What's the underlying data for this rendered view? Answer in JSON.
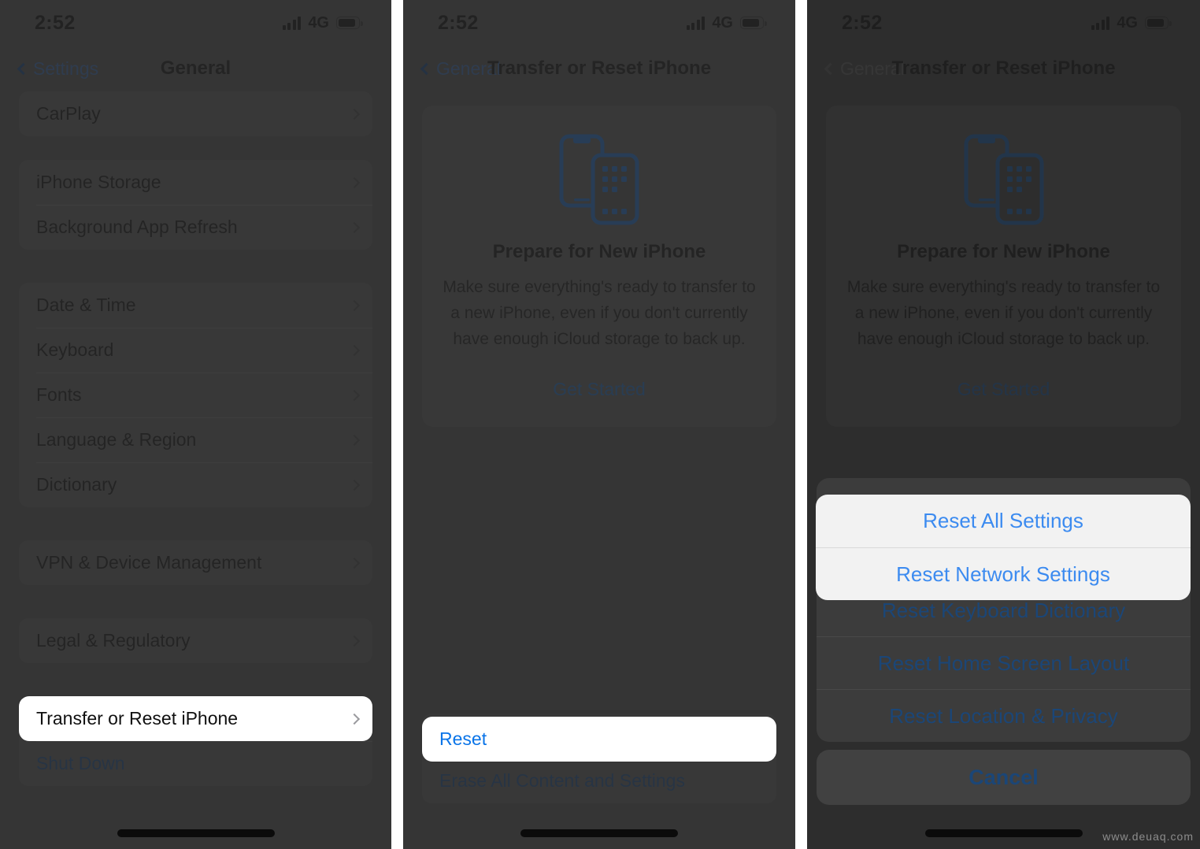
{
  "status_bar": {
    "time": "2:52",
    "network": "4G",
    "signal_icon": "signal-bars-icon",
    "battery_icon": "battery-icon"
  },
  "panel1": {
    "nav": {
      "back_label": "Settings",
      "title": "General",
      "back_icon": "chevron-left-icon"
    },
    "groups": [
      {
        "rows": [
          {
            "label": "CarPlay",
            "accessory": "chevron-right-icon"
          }
        ]
      },
      {
        "rows": [
          {
            "label": "iPhone Storage",
            "accessory": "chevron-right-icon"
          },
          {
            "label": "Background App Refresh",
            "accessory": "chevron-right-icon"
          }
        ]
      },
      {
        "rows": [
          {
            "label": "Date & Time",
            "accessory": "chevron-right-icon"
          },
          {
            "label": "Keyboard",
            "accessory": "chevron-right-icon"
          },
          {
            "label": "Fonts",
            "accessory": "chevron-right-icon"
          },
          {
            "label": "Language & Region",
            "accessory": "chevron-right-icon"
          },
          {
            "label": "Dictionary",
            "accessory": "chevron-right-icon"
          }
        ]
      },
      {
        "rows": [
          {
            "label": "VPN & Device Management",
            "accessory": "chevron-right-icon"
          }
        ]
      },
      {
        "rows": [
          {
            "label": "Legal & Regulatory",
            "accessory": "chevron-right-icon"
          }
        ]
      },
      {
        "rows": [
          {
            "label": "Transfer or Reset iPhone",
            "accessory": "chevron-right-icon",
            "highlighted": true
          },
          {
            "label": "Shut Down",
            "accessory": "",
            "link": true
          }
        ]
      }
    ]
  },
  "panel2": {
    "nav": {
      "back_label": "General",
      "title": "Transfer or Reset iPhone",
      "back_icon": "chevron-left-icon"
    },
    "prepare_card": {
      "icon": "two-phones-icon",
      "title": "Prepare for New iPhone",
      "body": "Make sure everything's ready to transfer to a new iPhone, even if you don't currently have enough iCloud storage to back up.",
      "link": "Get Started"
    },
    "reset_rows": [
      {
        "label": "Reset",
        "highlighted": true
      },
      {
        "label": "Erase All Content and Settings",
        "link": true
      }
    ]
  },
  "panel3": {
    "nav": {
      "back_label": "General",
      "title": "Transfer or Reset iPhone",
      "back_icon": "chevron-left-icon"
    },
    "prepare_card": {
      "icon": "two-phones-icon",
      "title": "Prepare for New iPhone",
      "body": "Make sure everything's ready to transfer to a new iPhone, even if you don't currently have enough iCloud storage to back up.",
      "link": "Get Started"
    },
    "action_sheet": {
      "items": [
        {
          "label": "Reset All Settings",
          "highlighted": true
        },
        {
          "label": "Reset Network Settings",
          "highlighted": true
        },
        {
          "label": "Reset Keyboard Dictionary",
          "highlighted": false
        },
        {
          "label": "Reset Home Screen Layout",
          "highlighted": false
        },
        {
          "label": "Reset Location & Privacy",
          "highlighted": false
        }
      ],
      "cancel_label": "Cancel"
    }
  },
  "colors": {
    "accent_blue": "#3c8bf0",
    "link_navy": "#1b4677",
    "icon_blue": "#1a4f8c",
    "screen_bg": "#3a3a3a",
    "card_bg": "#434343",
    "highlight_bg": "#ffffff"
  },
  "watermark": "www.deuaq.com"
}
